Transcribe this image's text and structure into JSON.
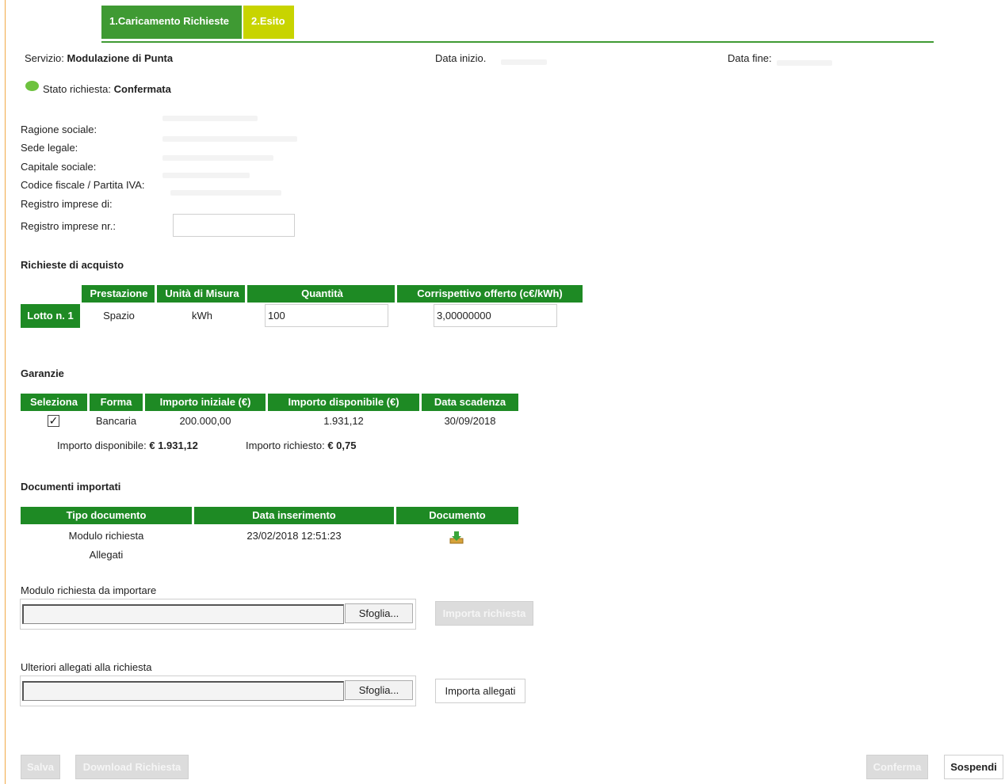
{
  "tabs": [
    {
      "label": "1.Caricamento Richieste"
    },
    {
      "label": "2.Esito"
    }
  ],
  "header": {
    "service_label": "Servizio:",
    "service_value": "Modulazione di Punta",
    "start_label": "Data inizio.",
    "end_label": "Data fine:",
    "status_label": "Stato richiesta:",
    "status_value": "Confermata",
    "status_color": "#6ec23f"
  },
  "company": {
    "fields": [
      "Ragione sociale:",
      "Sede legale:",
      "Capitale sociale:",
      "Codice fiscale / Partita IVA:",
      "Registro imprese di:",
      "Registro imprese nr.:"
    ],
    "registro_nr_value": ""
  },
  "purchase": {
    "title": "Richieste di acquisto",
    "columns": [
      "Prestazione",
      "Unità di Misura",
      "Quantità",
      "Corrispettivo offerto (c€/kWh)"
    ],
    "row_label": "Lotto n. 1",
    "prestazione": "Spazio",
    "unita": "kWh",
    "quantita": "100",
    "corrispettivo": "3,00000000"
  },
  "guarantees": {
    "title": "Garanzie",
    "columns": [
      "Seleziona",
      "Forma",
      "Importo iniziale (€)",
      "Importo disponibile (€)",
      "Data scadenza"
    ],
    "row": {
      "selected": true,
      "check_glyph": "✓",
      "forma": "Bancaria",
      "iniziale": "200.000,00",
      "disponibile": "1.931,12",
      "scadenza": "30/09/2018"
    },
    "available_label": "Importo disponibile:",
    "available_value": "€ 1.931,12",
    "requested_label": "Importo richiesto:",
    "requested_value": "€ 0,75"
  },
  "documents": {
    "title": "Documenti importati",
    "columns": [
      "Tipo documento",
      "Data inserimento",
      "Documento"
    ],
    "rows": [
      {
        "tipo": "Modulo richiesta",
        "data": "23/02/2018 12:51:23",
        "icon": "download-icon"
      },
      {
        "tipo": "Allegati",
        "data": ""
      }
    ]
  },
  "upload_request": {
    "label": "Modulo richiesta da importare",
    "browse": "Sfoglia...",
    "import": "Importa richiesta"
  },
  "upload_attachments": {
    "label": "Ulteriori allegati alla richiesta",
    "browse": "Sfoglia...",
    "import": "Importa allegati"
  },
  "footer": {
    "save": "Salva",
    "download": "Download Richiesta",
    "confirm": "Conferma",
    "suspend": "Sospendi"
  }
}
